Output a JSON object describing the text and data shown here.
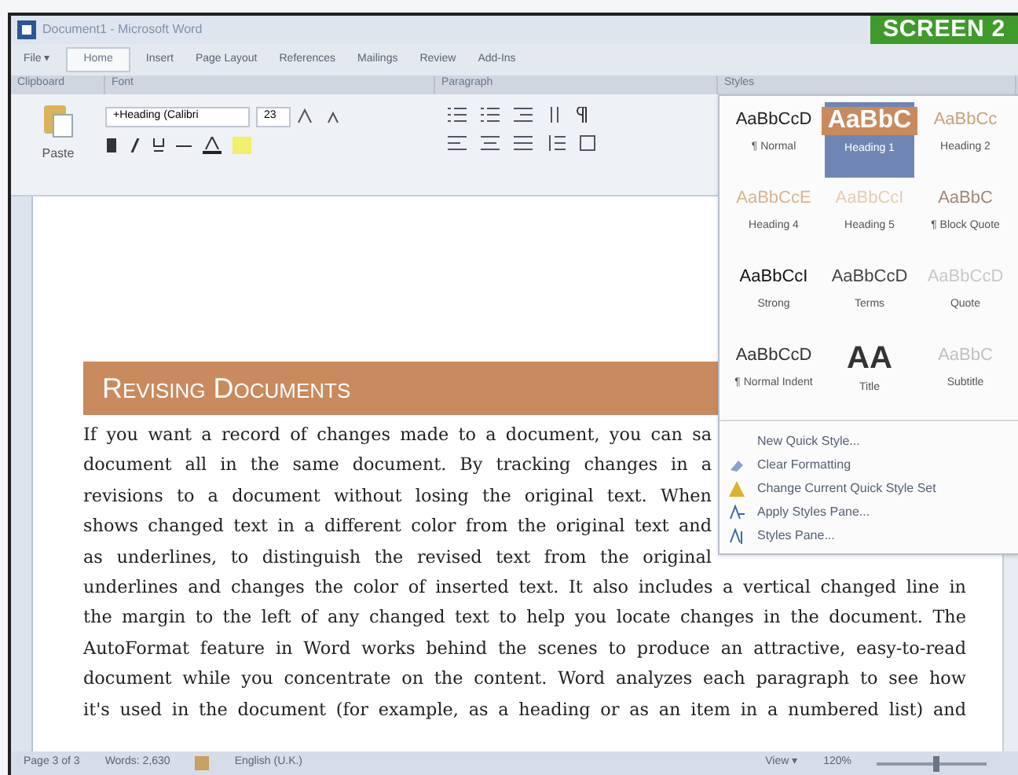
{
  "window": {
    "title": "Document1 - Microsoft Word"
  },
  "badge": "SCREEN 2",
  "tabs": [
    {
      "label": "File ▾",
      "selected": false
    },
    {
      "label": "Home",
      "selected": true
    },
    {
      "label": "Insert",
      "selected": false
    },
    {
      "label": "Page Layout",
      "selected": false
    },
    {
      "label": "References",
      "selected": false
    },
    {
      "label": "Mailings",
      "selected": false
    },
    {
      "label": "Review",
      "selected": false
    },
    {
      "label": "Add-Ins",
      "selected": false
    }
  ],
  "groups": [
    "Clipboard",
    "Font",
    "Paragraph",
    "Styles"
  ],
  "ribbon": {
    "paste": "Paste",
    "font_name": "+Heading (Calibri",
    "font_size": "23"
  },
  "styles_gallery": {
    "styles": [
      {
        "preview": "AaBbCcD",
        "label": "¶ Normal",
        "color": "#222222",
        "selected": false
      },
      {
        "preview": "AaBbC",
        "label": "Heading 1",
        "color": "#c98a5e",
        "selected": true
      },
      {
        "preview": "AaBbCc",
        "label": "Heading 2",
        "color": "#c9a27a",
        "selected": false
      },
      {
        "preview": "AaBbCcE",
        "label": "Heading 4",
        "color": "#d8b48c",
        "selected": false
      },
      {
        "preview": "AaBbCcI",
        "label": "Heading 5",
        "color": "#e4cdb2",
        "selected": false
      },
      {
        "preview": "AaBbC",
        "label": "¶ Block Quote",
        "color": "#a08878",
        "selected": false
      },
      {
        "preview": "AaBbCcI",
        "label": "Strong",
        "color": "#111111",
        "selected": false
      },
      {
        "preview": "AaBbCcD",
        "label": "Terms",
        "color": "#444444",
        "selected": false
      },
      {
        "preview": "AaBbCcD",
        "label": "Quote",
        "color": "#c8c8c8",
        "selected": false
      },
      {
        "preview": "AaBbCcD",
        "label": "¶ Normal Indent",
        "color": "#333333",
        "selected": false
      },
      {
        "preview": "AA",
        "label": "Title",
        "color": "#333333",
        "selected": false
      },
      {
        "preview": "AaBbC",
        "label": "Subtitle",
        "color": "#c0c0c0",
        "selected": false
      }
    ],
    "menu": [
      {
        "label": "New Quick Style...",
        "kind": "plain"
      },
      {
        "label": "Clear Formatting",
        "kind": "eraser"
      },
      {
        "label": "Change Current Quick Style Set",
        "kind": "styleset"
      },
      {
        "label": "Apply Styles Pane...",
        "kind": "apply"
      },
      {
        "label": "Styles Pane...",
        "kind": "pane"
      }
    ]
  },
  "document": {
    "heading": "Revising Documents",
    "lines": [
      "If you want a record of changes made to a document, you can sa",
      "document all in the same document.  By tracking changes in a",
      "revisions to a document without losing the original text.  When",
      "shows changed text in a different color from the original text and",
      "as underlines, to distinguish the revised text from the original",
      "underlines and changes the color of inserted text.  It also includes a vertical changed line in",
      "the margin to the left of any changed text to help you locate changes in the document.  The",
      "AutoFormat feature in Word works behind the scenes to produce an attractive, easy-to-read",
      "document while you concentrate on the content.  Word analyzes each paragraph to see how",
      "it's used in the document (for example, as a heading or as an item in a numbered list) and"
    ]
  },
  "status_bar": {
    "page": "Page 3 of 3",
    "words": "Words: 2,630",
    "language": "English (U.K.)",
    "view": "View ▾",
    "zoom": "120%",
    "zoom_slider": {
      "level": 0.55
    }
  }
}
